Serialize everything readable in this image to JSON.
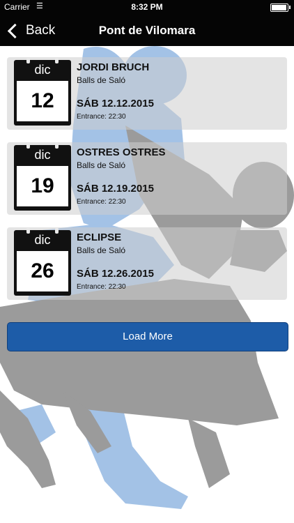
{
  "status_bar": {
    "carrier": "Carrier",
    "time": "8:32 PM"
  },
  "nav": {
    "back_label": "Back",
    "title": "Pont de Vilomara"
  },
  "events": [
    {
      "month": "dic",
      "day": "12",
      "name": "JORDI BRUCH",
      "category": "Balls de Saló",
      "date": "SÁB 12.12.2015",
      "entrance": "Entrance: 22:30"
    },
    {
      "month": "dic",
      "day": "19",
      "name": "OSTRES OSTRES",
      "category": "Balls de Saló",
      "date": "SÁB 12.19.2015",
      "entrance": "Entrance: 22:30"
    },
    {
      "month": "dic",
      "day": "26",
      "name": "ECLIPSE",
      "category": "Balls de Saló",
      "date": "SÁB 12.26.2015",
      "entrance": "Entrance: 22:30"
    }
  ],
  "load_more_label": "Load More",
  "colors": {
    "nav_bg": "#050505",
    "button": "#1d5ca8",
    "dancer_blue": "#9fbfe3",
    "dancer_gray": "#9a9a9a"
  }
}
